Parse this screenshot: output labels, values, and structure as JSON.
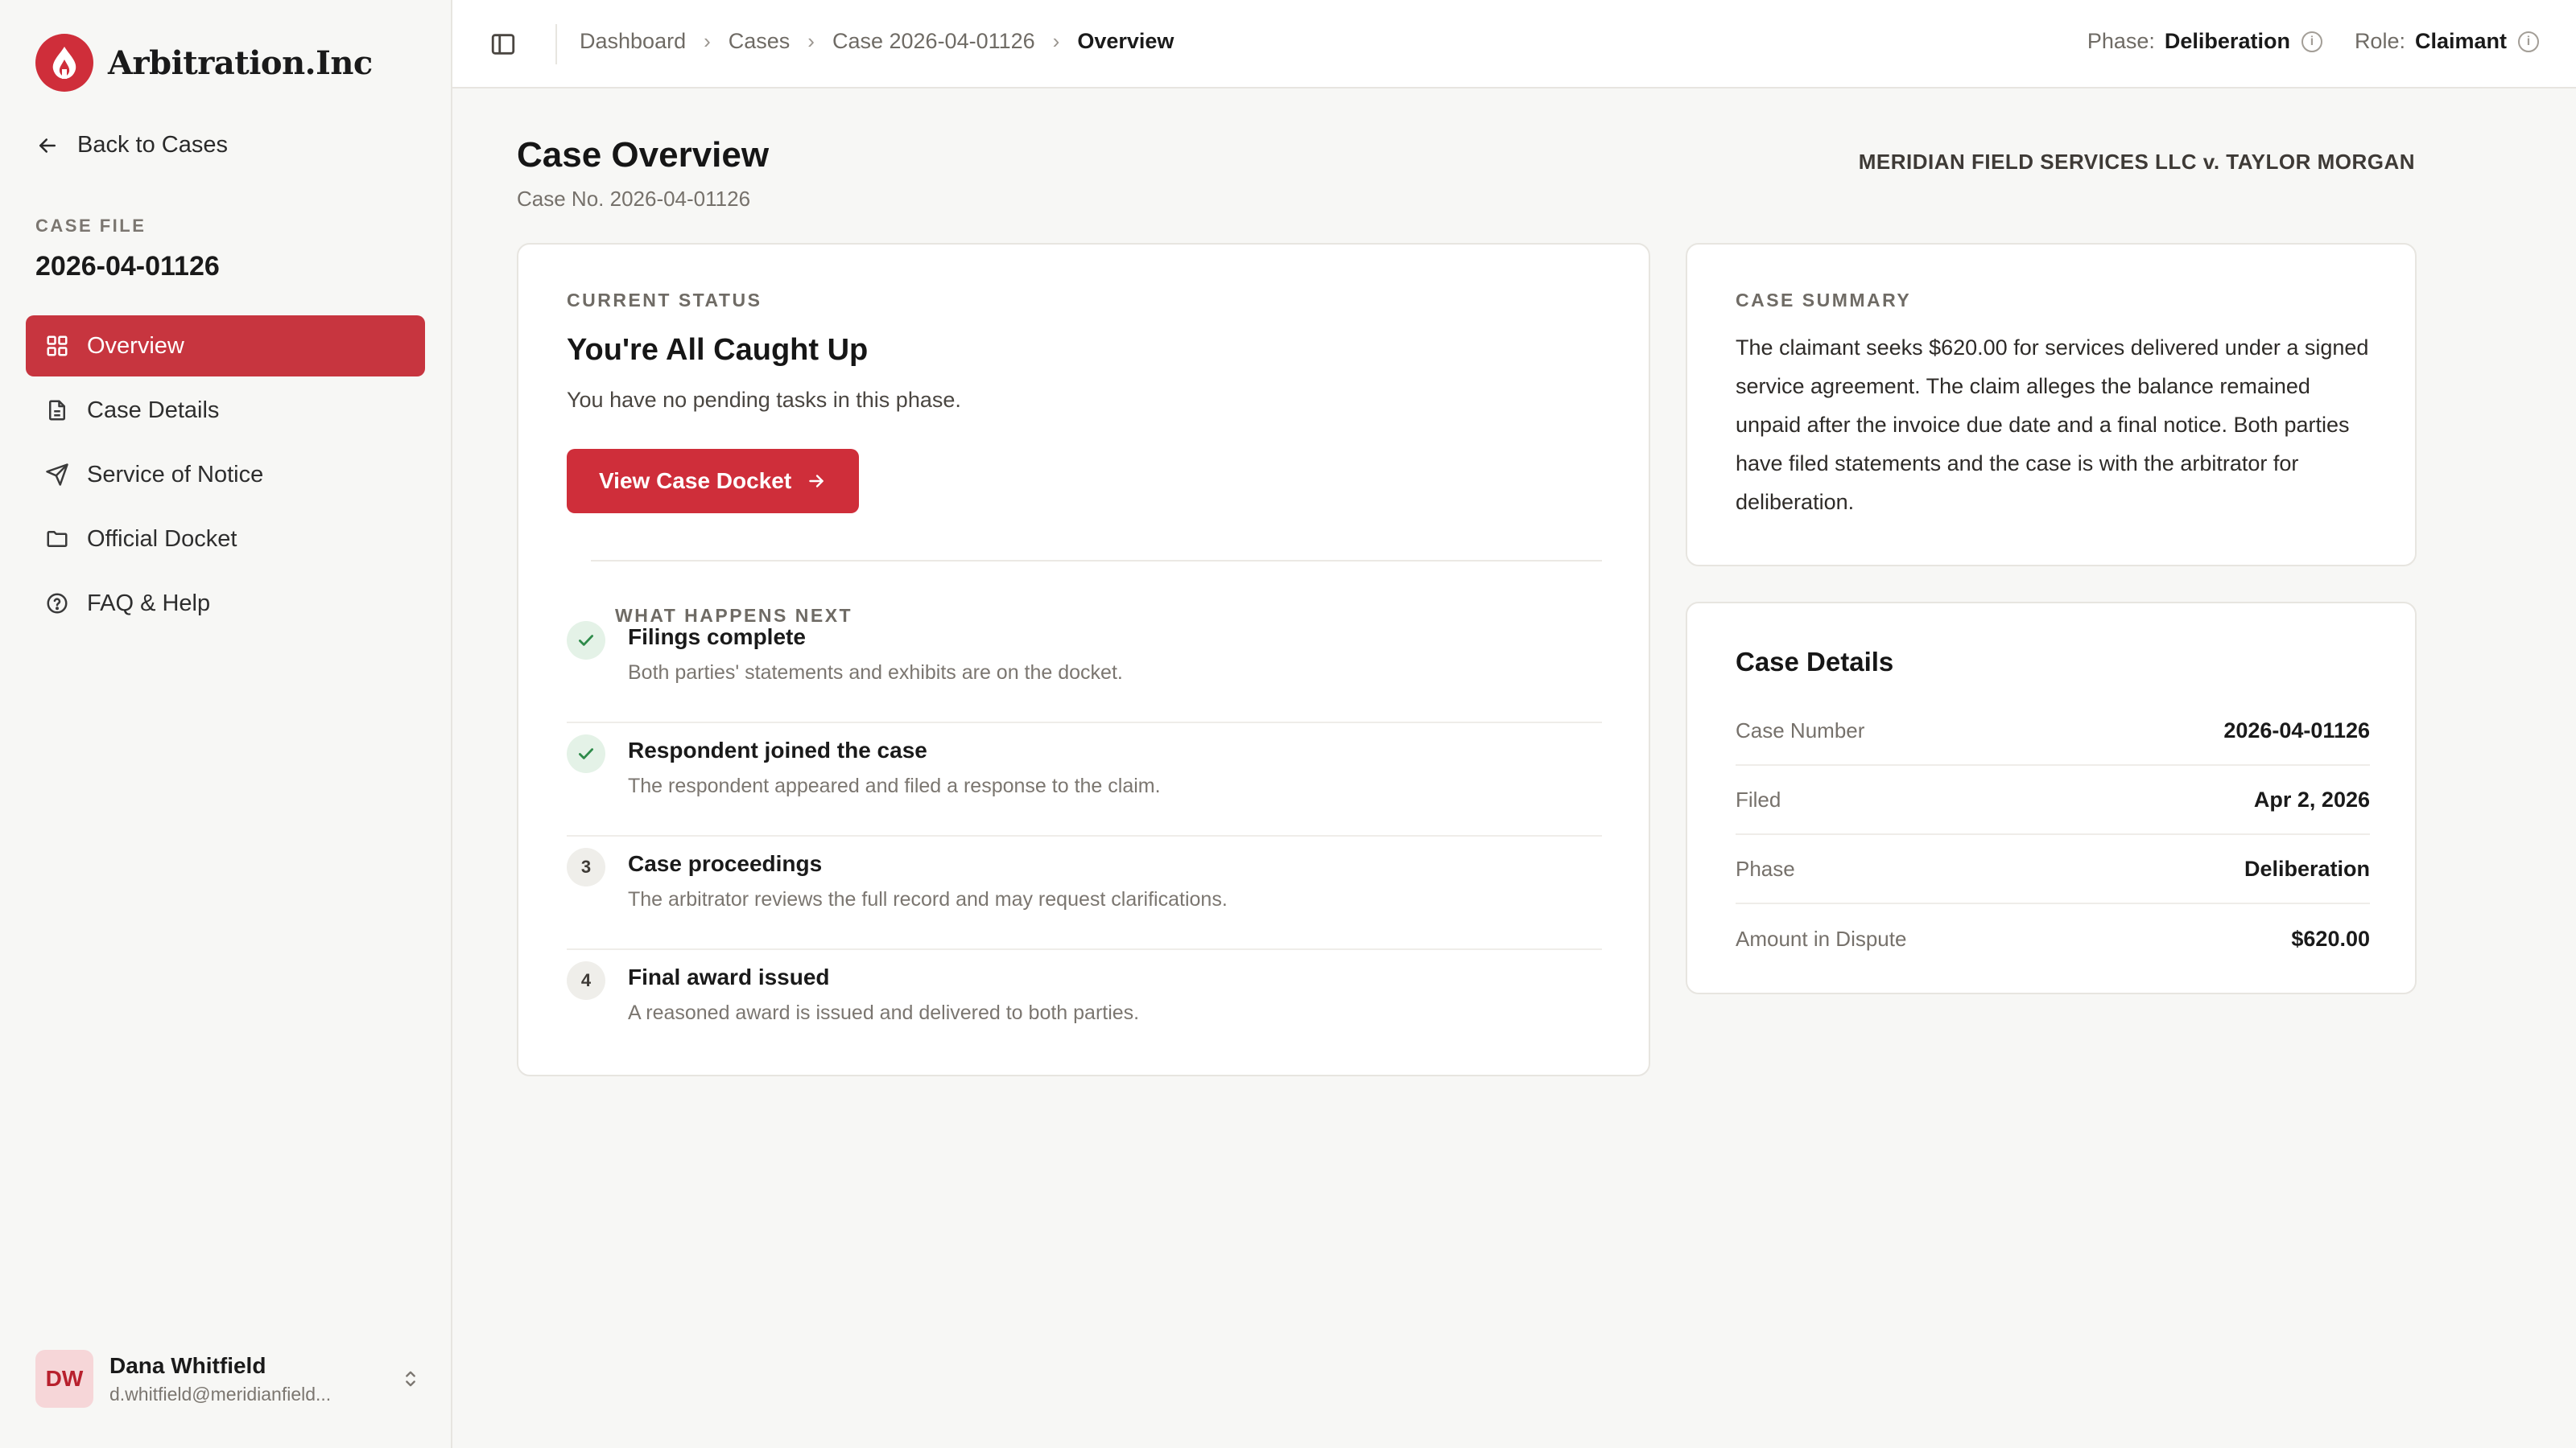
{
  "app": {
    "name": "Arbitration.Inc",
    "logo_icon": "flame-logo-icon"
  },
  "sidebar": {
    "back_label": "Back to Cases",
    "case_file_label": "CASE FILE",
    "case_file_number": "2026-04-01126",
    "items": [
      {
        "label": "Overview",
        "icon": "grid-icon",
        "active": true
      },
      {
        "label": "Case Details",
        "icon": "document-icon",
        "active": false
      },
      {
        "label": "Service of Notice",
        "icon": "send-icon",
        "active": false
      },
      {
        "label": "Official Docket",
        "icon": "folder-icon",
        "active": false
      },
      {
        "label": "FAQ & Help",
        "icon": "help-circle-icon",
        "active": false
      }
    ],
    "user": {
      "initials": "DW",
      "name": "Dana Whitfield",
      "email": "d.whitfield@meridianfield..."
    }
  },
  "header": {
    "breadcrumbs": [
      "Dashboard",
      "Cases",
      "Case 2026-04-01126",
      "Overview"
    ],
    "phase_label": "Phase:",
    "phase_value": "Deliberation",
    "role_label": "Role:",
    "role_value": "Claimant"
  },
  "page": {
    "title": "Case Overview",
    "subtitle": "Case No. 2026-04-01126",
    "parties": "MERIDIAN FIELD SERVICES LLC v. TAYLOR MORGAN"
  },
  "status": {
    "eyebrow": "CURRENT STATUS",
    "title": "You're All Caught Up",
    "description": "You have no pending tasks in this phase.",
    "button_label": "View Case Docket",
    "next_label": "WHAT HAPPENS NEXT",
    "steps": [
      {
        "badge": "",
        "done": true,
        "title": "Filings complete",
        "desc": "Both parties' statements and exhibits are on the docket."
      },
      {
        "badge": "",
        "done": true,
        "title": "Respondent joined the case",
        "desc": "The respondent appeared and filed a response to the claim."
      },
      {
        "badge": "3",
        "done": false,
        "title": "Case proceedings",
        "desc": "The arbitrator reviews the full record and may request clarifications."
      },
      {
        "badge": "4",
        "done": false,
        "title": "Final award issued",
        "desc": "A reasoned award is issued and delivered to both parties."
      }
    ]
  },
  "summary": {
    "eyebrow": "CASE SUMMARY",
    "text": "The claimant seeks $620.00 for services delivered under a signed service agreement. The claim alleges the balance remained unpaid after the invoice due date and a final notice. Both parties have filed statements and the case is with the arbitrator for deliberation."
  },
  "details": {
    "title": "Case Details",
    "rows": [
      {
        "label": "Case Number",
        "value": "2026-04-01126"
      },
      {
        "label": "Filed",
        "value": "Apr 2, 2026"
      },
      {
        "label": "Phase",
        "value": "Deliberation"
      },
      {
        "label": "Amount in Dispute",
        "value": "$620.00"
      }
    ]
  },
  "colors": {
    "brand": "#cf2e3a",
    "nav_active": "#c7353f",
    "success": "#2e8b4a"
  }
}
